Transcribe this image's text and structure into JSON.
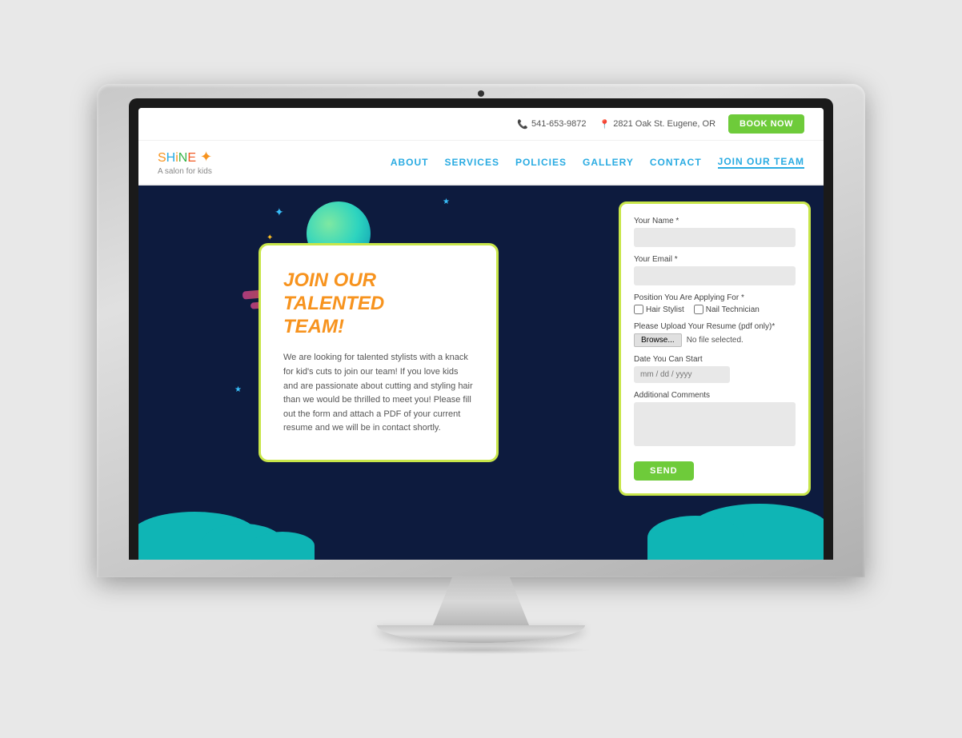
{
  "monitor": {
    "camera_label": "camera"
  },
  "topbar": {
    "phone": "541-653-9872",
    "phone_icon": "phone-icon",
    "address": "2821 Oak St. Eugene, OR",
    "address_icon": "location-icon",
    "book_button": "BOOK NOW"
  },
  "nav": {
    "logo": {
      "letters": [
        "S",
        "H",
        "I",
        "N",
        "E"
      ],
      "tagline": "A salon for kids"
    },
    "links": [
      {
        "label": "ABOUT",
        "id": "about"
      },
      {
        "label": "SERVICES",
        "id": "services"
      },
      {
        "label": "POLICIES",
        "id": "policies"
      },
      {
        "label": "GALLERY",
        "id": "gallery"
      },
      {
        "label": "CONTACT",
        "id": "contact"
      },
      {
        "label": "JOIN OUR TEAM",
        "id": "join",
        "active": true
      }
    ]
  },
  "hero": {
    "card": {
      "title_line1": "JOIN OUR TALENTED",
      "title_line2": "TEAM!",
      "description": "We are looking for talented stylists with a knack for kid's cuts to join our team! If you love kids and are passionate about cutting and styling hair than we would be thrilled to meet you! Please fill out the form and attach a PDF of your current resume and we will be in contact shortly."
    },
    "form": {
      "name_label": "Your Name *",
      "name_placeholder": "",
      "email_label": "Your Email *",
      "email_placeholder": "",
      "position_label": "Position You Are Applying For *",
      "position_option1": "Hair Stylist",
      "position_option2": "Nail Technician",
      "resume_label": "Please Upload Your Resume (pdf only)*",
      "browse_label": "Browse...",
      "no_file_label": "No file selected.",
      "date_label": "Date You Can Start",
      "date_placeholder": "mm / dd / yyyy",
      "comments_label": "Additional Comments",
      "send_button": "SEND"
    }
  }
}
